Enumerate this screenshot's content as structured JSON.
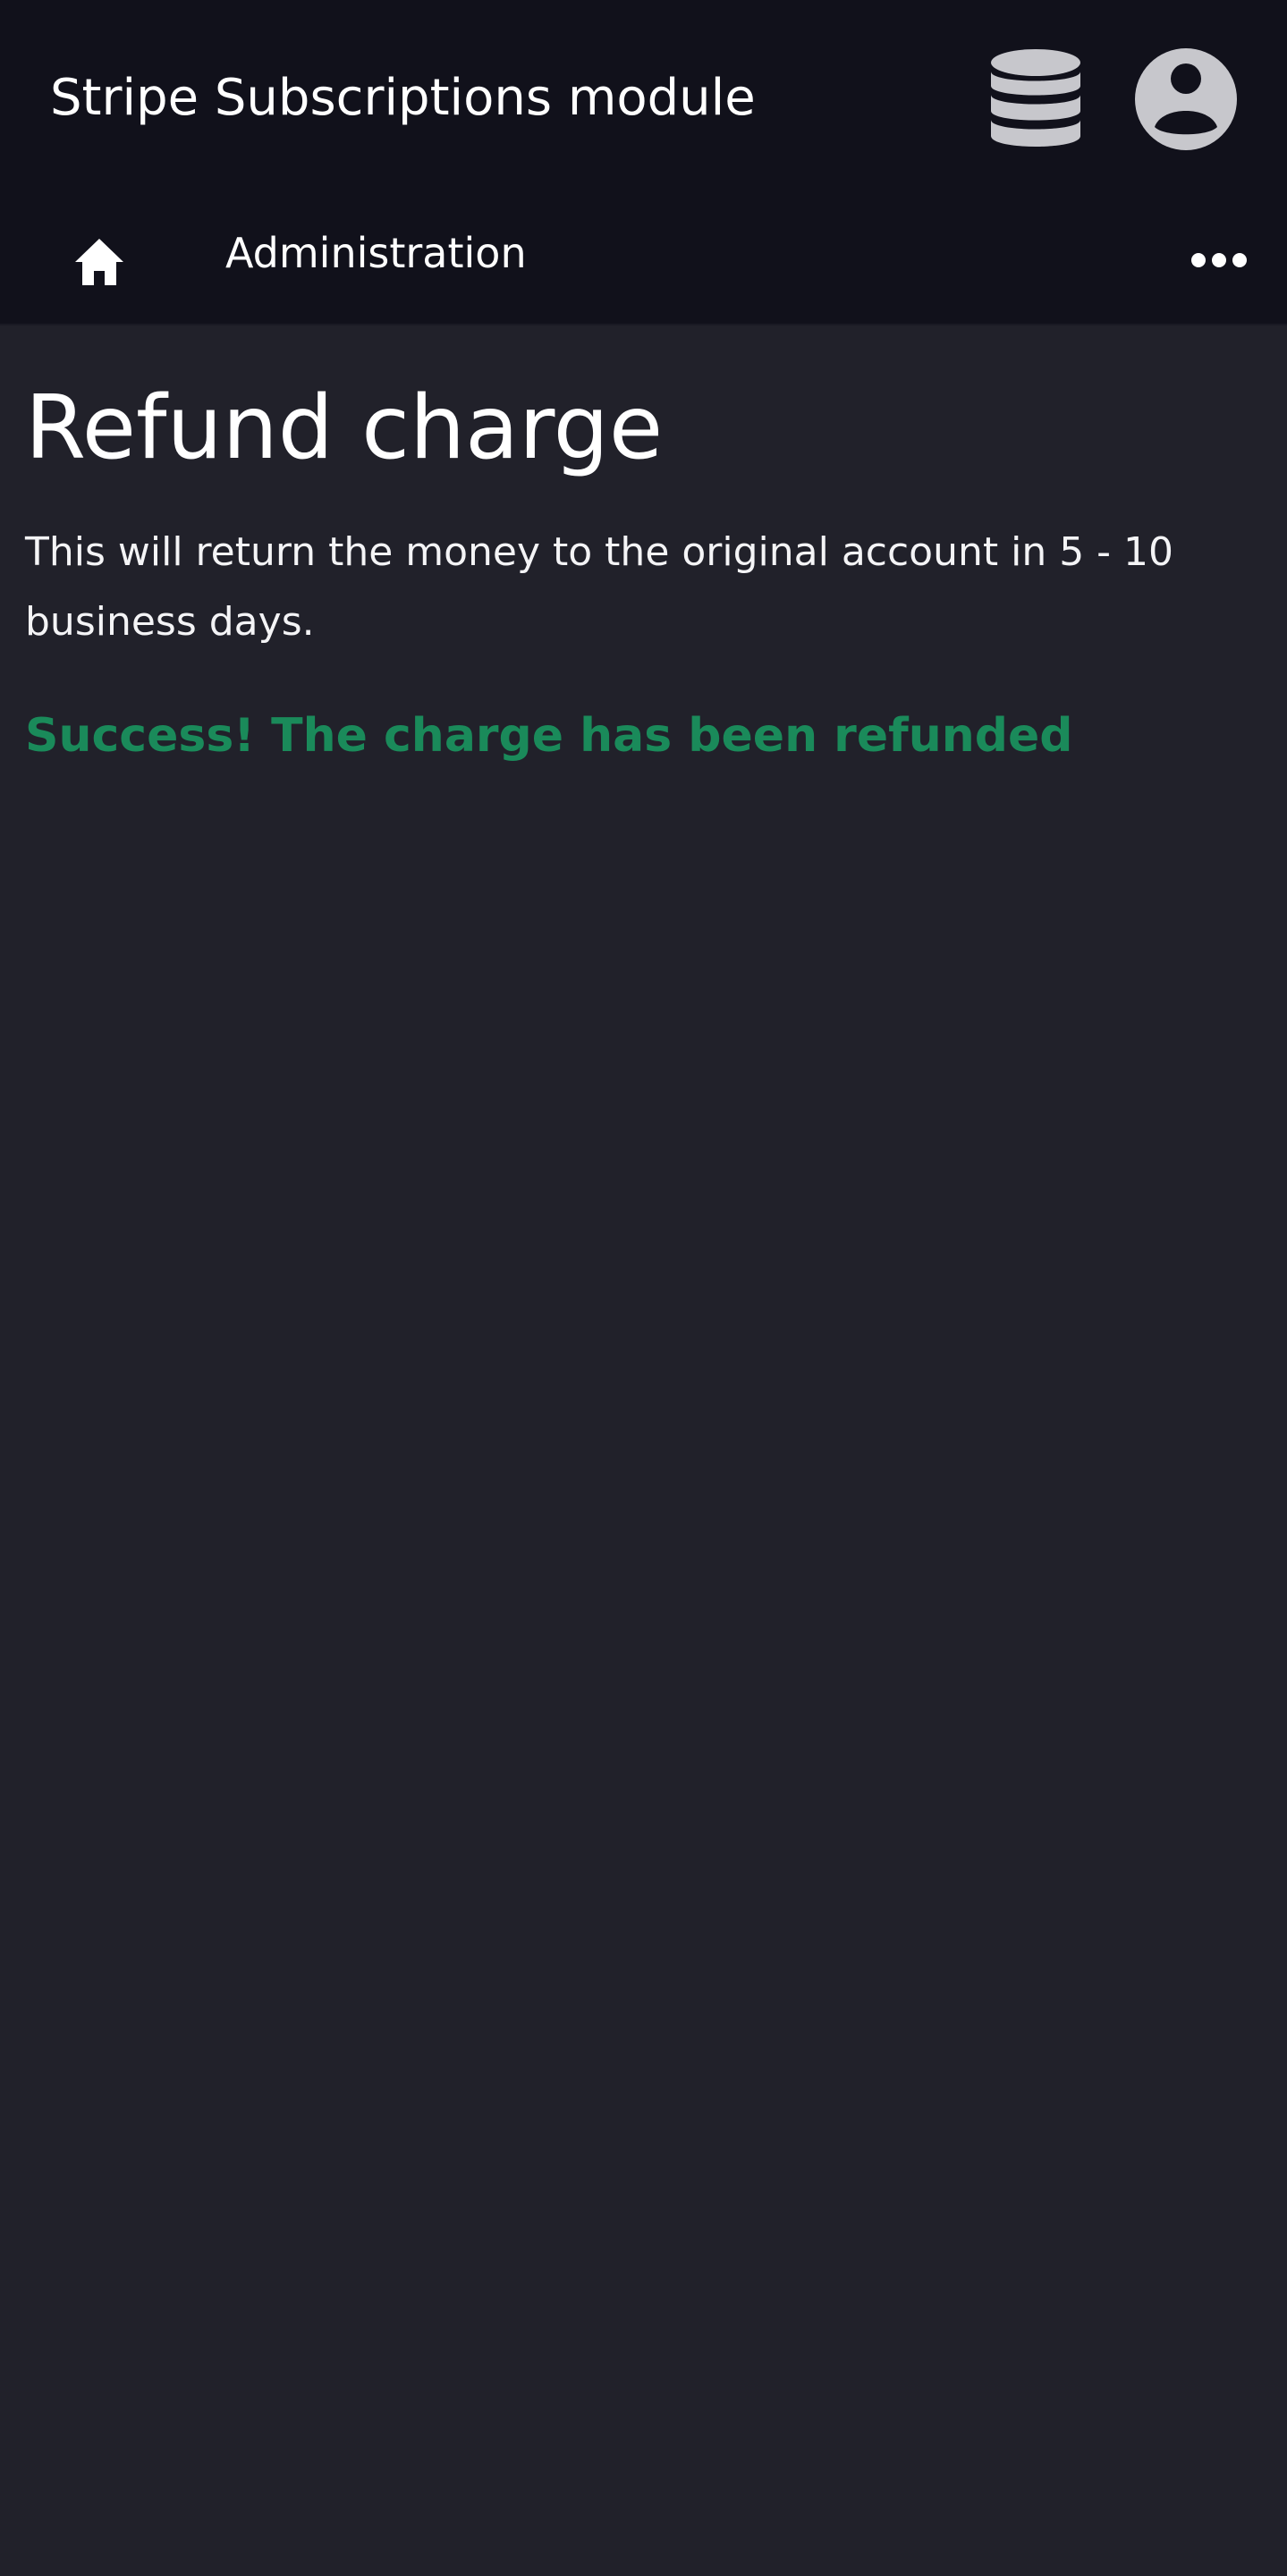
{
  "app": {
    "title": "Stripe Subscriptions module"
  },
  "header": {
    "database_icon": "database-icon",
    "account_icon": "user-circle-icon"
  },
  "nav": {
    "home_icon": "home-icon",
    "items": [
      {
        "label": "Administration"
      }
    ],
    "more_icon": "ellipsis-icon"
  },
  "main": {
    "title": "Refund charge",
    "description": "This will return the money to the original account in 5 - 10 business days.",
    "status_message": "Success! The charge has been refunded"
  },
  "colors": {
    "topbar_bg": "#11111b",
    "page_bg": "#21212a",
    "success": "#1a8a5a",
    "icon_gray": "#c7c7cc"
  }
}
